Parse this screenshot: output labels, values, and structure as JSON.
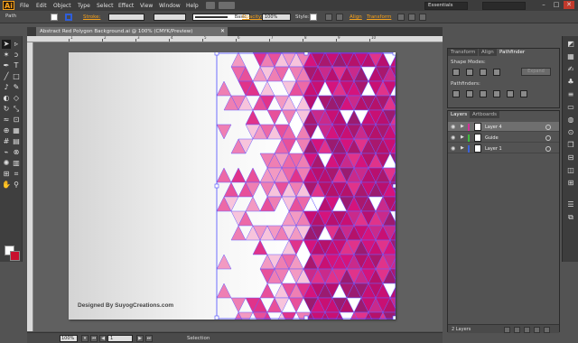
{
  "app": {
    "logo": "Ai"
  },
  "menu": [
    "File",
    "Edit",
    "Object",
    "Type",
    "Select",
    "Effect",
    "View",
    "Window",
    "Help"
  ],
  "workspace": "Essentials",
  "window_controls": {
    "minimize": "–",
    "maximize": "□",
    "close": "✕"
  },
  "control_bar": {
    "selection_type": "Path",
    "stroke_label": "Stroke:",
    "brush_label": "Basic",
    "opacity_label": "Opacity:",
    "opacity_value": "100%",
    "style_label": "Style:",
    "align_label": "Align",
    "transform_label": "Transform"
  },
  "document": {
    "tab_title": "Abstract Red Polygon Background.ai @ 100% (CMYK/Preview)",
    "credit_text": "Designed By SuyogCreations.com"
  },
  "ruler": {
    "marks": [
      "1",
      "2",
      "3",
      "4",
      "5",
      "6",
      "7",
      "8",
      "9",
      "10"
    ]
  },
  "status_bar": {
    "zoom": "100%",
    "page": "1",
    "status_text": "Selection"
  },
  "pathfinder_panel": {
    "tabs": [
      "Transform",
      "Align",
      "Pathfinder"
    ],
    "active_tab": "Pathfinder",
    "shape_modes_label": "Shape Modes:",
    "pathfinders_label": "Pathfinders:",
    "expand_label": "Expand"
  },
  "layers_panel": {
    "tabs": [
      "Layers",
      "Artboards"
    ],
    "active_tab": "Layers",
    "layers": [
      {
        "name": "Layer 4",
        "color": "#d42e9a",
        "selected": true
      },
      {
        "name": "Guide",
        "color": "#3fbd3f",
        "selected": false
      },
      {
        "name": "Layer 1",
        "color": "#3b62d9",
        "selected": false
      }
    ],
    "count_label": "2 Layers"
  },
  "colors": {
    "accent": "#f7a21b",
    "selection": "#4b4bff",
    "fill_swatch": "#ffffff",
    "stroke_swatch": "#c8102e"
  },
  "icons": {
    "toolbar": [
      "selection-tool-icon",
      "direct-selection-tool-icon",
      "magic-wand-icon",
      "lasso-icon",
      "pen-icon",
      "type-icon",
      "line-icon",
      "rectangle-icon",
      "paintbrush-icon",
      "pencil-icon",
      "blob-brush-icon",
      "eraser-icon",
      "rotate-icon",
      "scale-icon",
      "width-icon",
      "free-transform-icon",
      "shape-builder-icon",
      "perspective-grid-icon",
      "mesh-icon",
      "gradient-icon",
      "eyedropper-icon",
      "blend-icon",
      "symbol-sprayer-icon",
      "column-graph-icon",
      "artboard-icon",
      "slice-icon",
      "hand-icon",
      "zoom-icon"
    ]
  }
}
